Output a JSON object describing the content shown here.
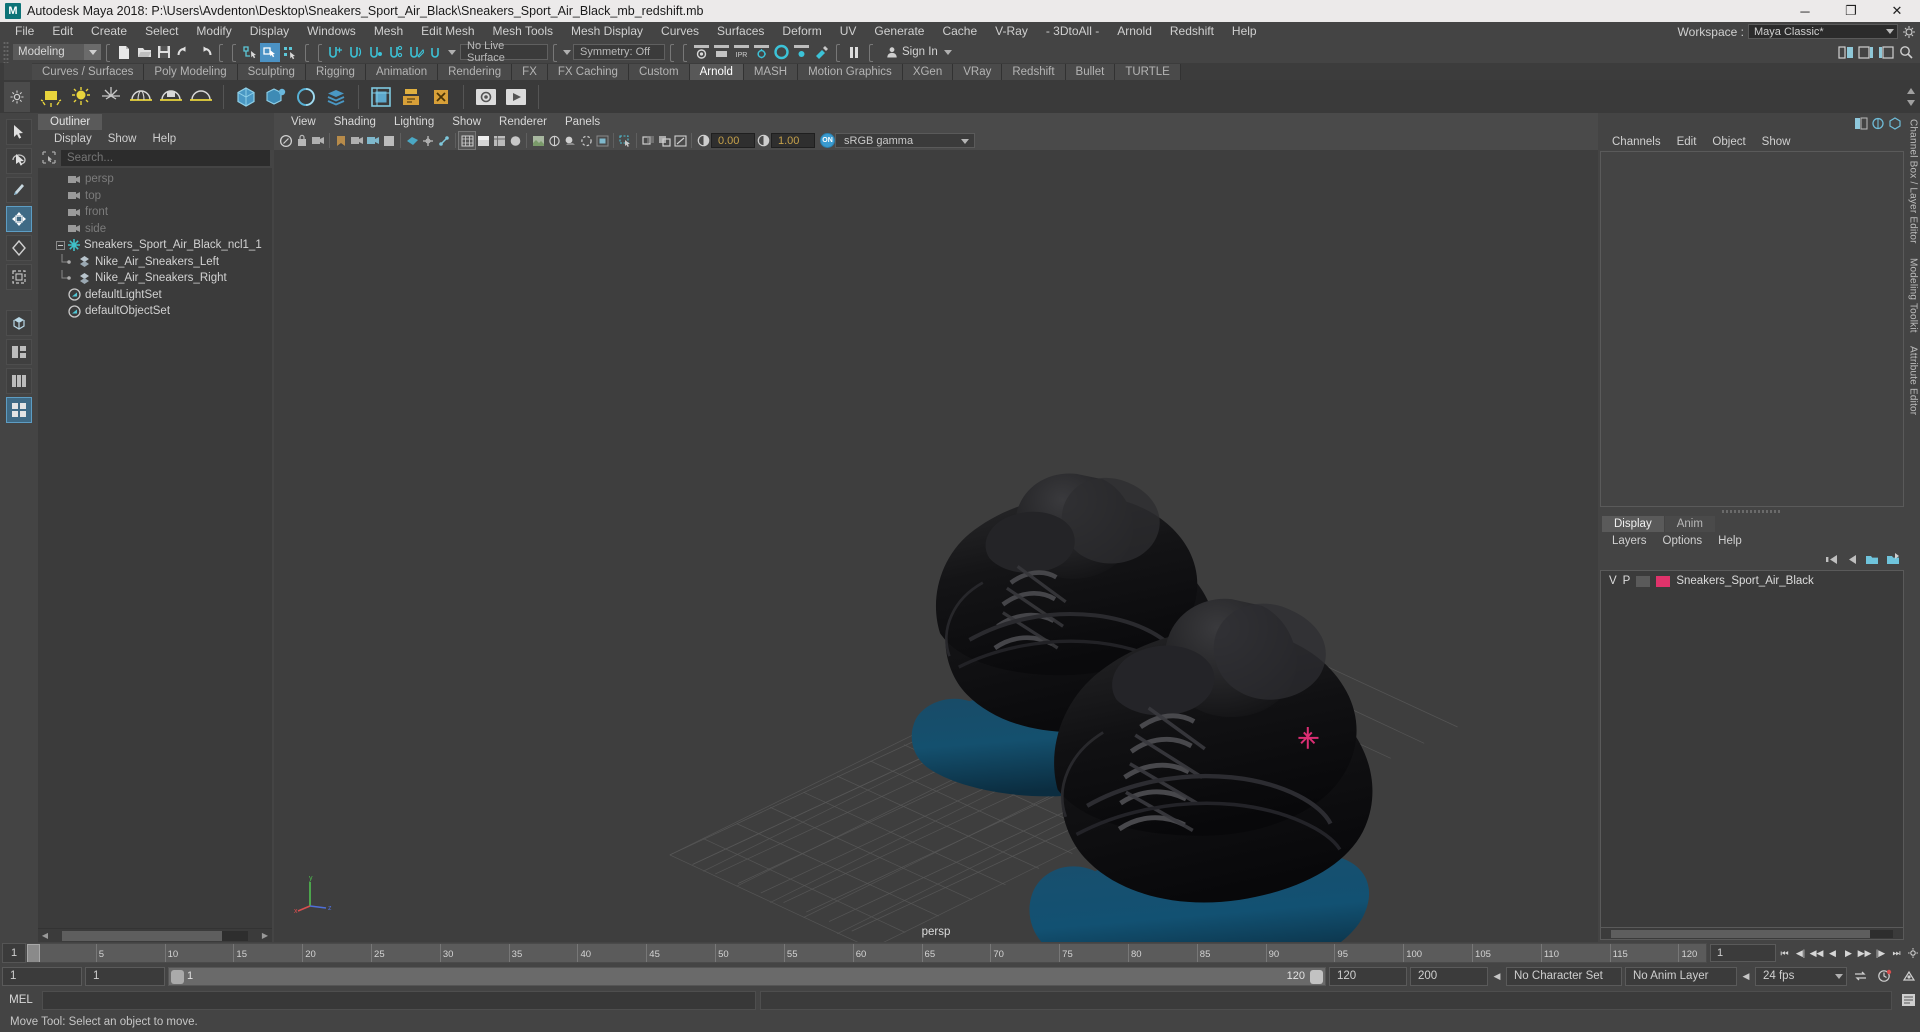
{
  "window": {
    "title": "Autodesk Maya 2018: P:\\Users\\Avdenton\\Desktop\\Sneakers_Sport_Air_Black\\Sneakers_Sport_Air_Black_mb_redshift.mb",
    "logo_letter": "M",
    "minimize": "─",
    "maximize": "❐",
    "close": "✕"
  },
  "menubar": {
    "items": [
      "File",
      "Edit",
      "Create",
      "Select",
      "Modify",
      "Display",
      "Windows",
      "Mesh",
      "Edit Mesh",
      "Mesh Tools",
      "Mesh Display",
      "Curves",
      "Surfaces",
      "Deform",
      "UV",
      "Generate",
      "Cache",
      "V-Ray",
      "- 3DtoAll -",
      "Arnold",
      "Redshift",
      "Help"
    ],
    "workspace_label": "Workspace :",
    "workspace_value": "Maya Classic*"
  },
  "statusbar": {
    "mode": "Modeling",
    "live_surface": "No Live Surface",
    "symmetry": "Symmetry: Off",
    "signin": "Sign In"
  },
  "shelf": {
    "tabs": [
      {
        "label": "Curves / Surfaces",
        "active": false
      },
      {
        "label": "Poly Modeling",
        "active": false
      },
      {
        "label": "Sculpting",
        "active": false
      },
      {
        "label": "Rigging",
        "active": false
      },
      {
        "label": "Animation",
        "active": false
      },
      {
        "label": "Rendering",
        "active": false
      },
      {
        "label": "FX",
        "active": false
      },
      {
        "label": "FX Caching",
        "active": false
      },
      {
        "label": "Custom",
        "active": false
      },
      {
        "label": "Arnold",
        "active": true
      },
      {
        "label": "MASH",
        "active": false
      },
      {
        "label": "Motion Graphics",
        "active": false
      },
      {
        "label": "XGen",
        "active": false
      },
      {
        "label": "VRay",
        "active": false
      },
      {
        "label": "Redshift",
        "active": false
      },
      {
        "label": "Bullet",
        "active": false
      },
      {
        "label": "TURTLE",
        "active": false
      }
    ]
  },
  "outliner": {
    "tab": "Outliner",
    "menus": [
      "Display",
      "Show",
      "Help"
    ],
    "search_placeholder": "Search...",
    "items": [
      {
        "label": "persp",
        "icon": "camera-icon",
        "indent": 1,
        "dim": true,
        "expander": false
      },
      {
        "label": "top",
        "icon": "camera-icon",
        "indent": 1,
        "dim": true,
        "expander": false
      },
      {
        "label": "front",
        "icon": "camera-icon",
        "indent": 1,
        "dim": true,
        "expander": false
      },
      {
        "label": "side",
        "icon": "camera-icon",
        "indent": 1,
        "dim": true,
        "expander": false
      },
      {
        "label": "Sneakers_Sport_Air_Black_ncl1_1",
        "icon": "group-star-icon",
        "indent": 0,
        "dim": false,
        "expander": true
      },
      {
        "label": "Nike_Air_Sneakers_Left",
        "icon": "mesh-icon",
        "indent": 2,
        "dim": false,
        "expander": false
      },
      {
        "label": "Nike_Air_Sneakers_Right",
        "icon": "mesh-icon",
        "indent": 2,
        "dim": false,
        "expander": false
      },
      {
        "label": "defaultLightSet",
        "icon": "set-icon",
        "indent": 1,
        "dim": false,
        "expander": false
      },
      {
        "label": "defaultObjectSet",
        "icon": "set-icon",
        "indent": 1,
        "dim": false,
        "expander": false
      }
    ]
  },
  "viewport": {
    "menus": [
      "View",
      "Shading",
      "Lighting",
      "Show",
      "Renderer",
      "Panels"
    ],
    "exposure": "0.00",
    "gamma": "1.00",
    "color_space": "sRGB gamma",
    "camera_label": "persp",
    "axis": {
      "x": "x",
      "y": "y",
      "z": "z"
    }
  },
  "channelbox": {
    "menus": [
      "Channels",
      "Edit",
      "Object",
      "Show"
    ]
  },
  "layers": {
    "tabs": [
      {
        "label": "Display",
        "active": true
      },
      {
        "label": "Anim",
        "active": false
      }
    ],
    "menus": [
      "Layers",
      "Options",
      "Help"
    ],
    "col_v": "V",
    "col_p": "P",
    "rows": [
      {
        "visible": "V",
        "playback": "P",
        "color": "#e0336b",
        "name": "Sneakers_Sport_Air_Black"
      }
    ]
  },
  "vertical_tabs": [
    "Channel Box / Layer Editor",
    "Modeling Toolkit",
    "Attribute Editor"
  ],
  "timeline": {
    "start_label": "1",
    "ticks": [
      {
        "v": "5",
        "pos": 5
      },
      {
        "v": "10",
        "pos": 10
      },
      {
        "v": "15",
        "pos": 15
      },
      {
        "v": "20",
        "pos": 20
      },
      {
        "v": "25",
        "pos": 25
      },
      {
        "v": "30",
        "pos": 30
      },
      {
        "v": "35",
        "pos": 35
      },
      {
        "v": "40",
        "pos": 40
      },
      {
        "v": "45",
        "pos": 45
      },
      {
        "v": "50",
        "pos": 50
      },
      {
        "v": "55",
        "pos": 55
      },
      {
        "v": "60",
        "pos": 60
      },
      {
        "v": "65",
        "pos": 65
      },
      {
        "v": "70",
        "pos": 70
      },
      {
        "v": "75",
        "pos": 75
      },
      {
        "v": "80",
        "pos": 80
      },
      {
        "v": "85",
        "pos": 85
      },
      {
        "v": "90",
        "pos": 90
      },
      {
        "v": "95",
        "pos": 95
      },
      {
        "v": "100",
        "pos": 100
      },
      {
        "v": "105",
        "pos": 105
      },
      {
        "v": "110",
        "pos": 110
      },
      {
        "v": "115",
        "pos": 115
      },
      {
        "v": "120",
        "pos": 120
      }
    ],
    "current_frame": "1"
  },
  "rangeslider": {
    "anim_start": "1",
    "range_start": "1",
    "bar_left": "1",
    "bar_right": "120",
    "range_end": "120",
    "anim_end": "200",
    "character_set": "No Character Set",
    "anim_layer": "No Anim Layer",
    "fps": "24 fps"
  },
  "mel": {
    "label": "MEL",
    "value": ""
  },
  "helpline": {
    "text": "Move Tool: Select an object to move."
  }
}
